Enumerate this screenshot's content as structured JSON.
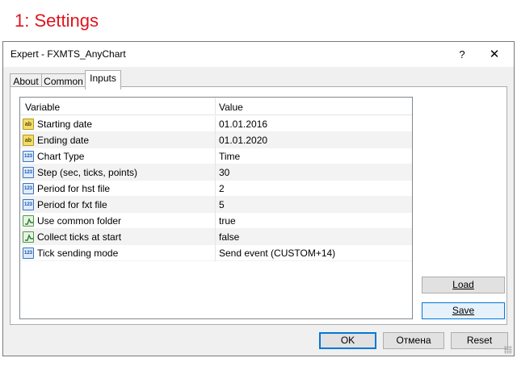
{
  "page_heading": "1: Settings",
  "window": {
    "title": "Expert - FXMTS_AnyChart",
    "help_label": "?",
    "close_label": "✕"
  },
  "tabs": [
    {
      "label": "About",
      "active": false
    },
    {
      "label": "Common",
      "active": false
    },
    {
      "label": "Inputs",
      "active": true
    }
  ],
  "grid": {
    "headers": {
      "variable": "Variable",
      "value": "Value"
    },
    "rows": [
      {
        "icon": "ab",
        "type": "string",
        "variable": "Starting date",
        "value": "01.01.2016"
      },
      {
        "icon": "ab",
        "type": "string",
        "variable": "Ending date",
        "value": "01.01.2020"
      },
      {
        "icon": "123",
        "type": "number",
        "variable": "Chart Type",
        "value": "Time"
      },
      {
        "icon": "123",
        "type": "number",
        "variable": "Step (sec, ticks, points)",
        "value": "30"
      },
      {
        "icon": "123",
        "type": "number",
        "variable": "Period for hst file",
        "value": "2"
      },
      {
        "icon": "123",
        "type": "number",
        "variable": "Period for fxt file",
        "value": "5"
      },
      {
        "icon": "bool",
        "type": "bool",
        "variable": "Use common folder",
        "value": "true"
      },
      {
        "icon": "bool",
        "type": "bool",
        "variable": "Collect ticks at start",
        "value": "false"
      },
      {
        "icon": "123",
        "type": "number",
        "variable": "Tick sending mode",
        "value": "Send event (CUSTOM+14)"
      }
    ]
  },
  "side_buttons": {
    "load": "Load",
    "save": "Save"
  },
  "footer_buttons": {
    "ok": "OK",
    "cancel": "Отмена",
    "reset": "Reset"
  }
}
